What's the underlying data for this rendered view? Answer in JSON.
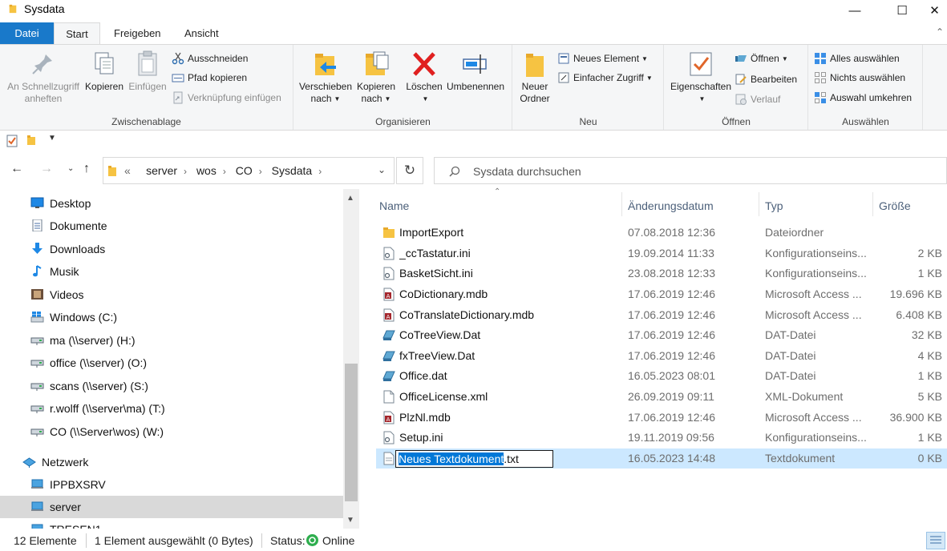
{
  "window": {
    "title": "Sysdata",
    "minimize": "—",
    "maximize": "☐",
    "close": "✕"
  },
  "ribbon_tabs": {
    "file": "Datei",
    "start": "Start",
    "share": "Freigeben",
    "view": "Ansicht"
  },
  "ribbon": {
    "clipboard": {
      "label": "Zwischenablage",
      "pin": "An Schnellzugriff anheften",
      "copy": "Kopieren",
      "paste": "Einfügen",
      "cut": "Ausschneiden",
      "copy_path": "Pfad kopieren",
      "paste_shortcut": "Verknüpfung einfügen"
    },
    "organize": {
      "label": "Organisieren",
      "move_to_1": "Verschieben",
      "move_to_2": "nach",
      "copy_to_1": "Kopieren",
      "copy_to_2": "nach",
      "delete": "Löschen",
      "rename": "Umbenennen"
    },
    "new": {
      "label": "Neu",
      "new_folder_1": "Neuer",
      "new_folder_2": "Ordner",
      "new_item": "Neues Element",
      "easy_access": "Einfacher Zugriff"
    },
    "open": {
      "label": "Öffnen",
      "properties": "Eigenschaften",
      "open": "Öffnen",
      "edit": "Bearbeiten",
      "history": "Verlauf"
    },
    "select": {
      "label": "Auswählen",
      "select_all": "Alles auswählen",
      "select_none": "Nichts auswählen",
      "invert": "Auswahl umkehren"
    }
  },
  "address": {
    "overflow": "«",
    "crumbs": [
      "server",
      "wos",
      "CO",
      "Sysdata"
    ],
    "search_placeholder": "Sysdata durchsuchen"
  },
  "nav_pane": {
    "items": [
      {
        "label": "Desktop",
        "icon": "desktop-icon"
      },
      {
        "label": "Dokumente",
        "icon": "documents-icon"
      },
      {
        "label": "Downloads",
        "icon": "downloads-icon"
      },
      {
        "label": "Musik",
        "icon": "music-icon"
      },
      {
        "label": "Videos",
        "icon": "videos-icon"
      },
      {
        "label": "Windows  (C:)",
        "icon": "drive-icon"
      },
      {
        "label": "ma (\\\\server) (H:)",
        "icon": "network-drive-icon"
      },
      {
        "label": "office (\\\\server) (O:)",
        "icon": "network-drive-icon"
      },
      {
        "label": "scans (\\\\server) (S:)",
        "icon": "network-drive-icon"
      },
      {
        "label": "r.wolff (\\\\server\\ma) (T:)",
        "icon": "network-drive-icon"
      },
      {
        "label": "CO (\\\\Server\\wos) (W:)",
        "icon": "network-drive-icon"
      },
      {
        "label": "Netzwerk",
        "icon": "network-icon"
      },
      {
        "label": "IPPBXSRV",
        "icon": "computer-icon"
      },
      {
        "label": "server",
        "icon": "computer-icon"
      },
      {
        "label": "TRESEN1",
        "icon": "computer-icon"
      }
    ]
  },
  "file_list": {
    "columns": {
      "name": "Name",
      "date": "Änderungsdatum",
      "type": "Typ",
      "size": "Größe"
    },
    "rows": [
      {
        "name": "ImportExport",
        "date": "07.08.2018 12:36",
        "type": "Dateiordner",
        "size": "",
        "icon": "folder-icon"
      },
      {
        "name": "_ccTastatur.ini",
        "date": "19.09.2014 11:33",
        "type": "Konfigurationseins...",
        "size": "2 KB",
        "icon": "ini-file-icon"
      },
      {
        "name": "BasketSicht.ini",
        "date": "23.08.2018 12:33",
        "type": "Konfigurationseins...",
        "size": "1 KB",
        "icon": "ini-file-icon"
      },
      {
        "name": "CoDictionary.mdb",
        "date": "17.06.2019 12:46",
        "type": "Microsoft Access ...",
        "size": "19.696 KB",
        "icon": "access-file-icon"
      },
      {
        "name": "CoTranslateDictionary.mdb",
        "date": "17.06.2019 12:46",
        "type": "Microsoft Access ...",
        "size": "6.408 KB",
        "icon": "access-file-icon"
      },
      {
        "name": "CoTreeView.Dat",
        "date": "17.06.2019 12:46",
        "type": "DAT-Datei",
        "size": "32 KB",
        "icon": "dat-file-icon"
      },
      {
        "name": "fxTreeView.Dat",
        "date": "17.06.2019 12:46",
        "type": "DAT-Datei",
        "size": "4 KB",
        "icon": "dat-file-icon"
      },
      {
        "name": "Office.dat",
        "date": "16.05.2023 08:01",
        "type": "DAT-Datei",
        "size": "1 KB",
        "icon": "dat-file-icon"
      },
      {
        "name": "OfficeLicense.xml",
        "date": "26.09.2019 09:11",
        "type": "XML-Dokument",
        "size": "5 KB",
        "icon": "xml-file-icon"
      },
      {
        "name": "PlzNl.mdb",
        "date": "17.06.2019 12:46",
        "type": "Microsoft Access ...",
        "size": "36.900 KB",
        "icon": "access-file-icon"
      },
      {
        "name": "Setup.ini",
        "date": "19.11.2019 09:56",
        "type": "Konfigurationseins...",
        "size": "1 KB",
        "icon": "ini-file-icon"
      }
    ],
    "renaming_row": {
      "name_selected": "Neues Textdokument",
      "name_ext": ".txt",
      "date": "16.05.2023 14:48",
      "type": "Textdokument",
      "size": "0 KB"
    }
  },
  "status": {
    "count": "12 Elemente",
    "selection": "1 Element ausgewählt (0 Bytes)",
    "status_label": "Status:",
    "status_value": "Online"
  }
}
